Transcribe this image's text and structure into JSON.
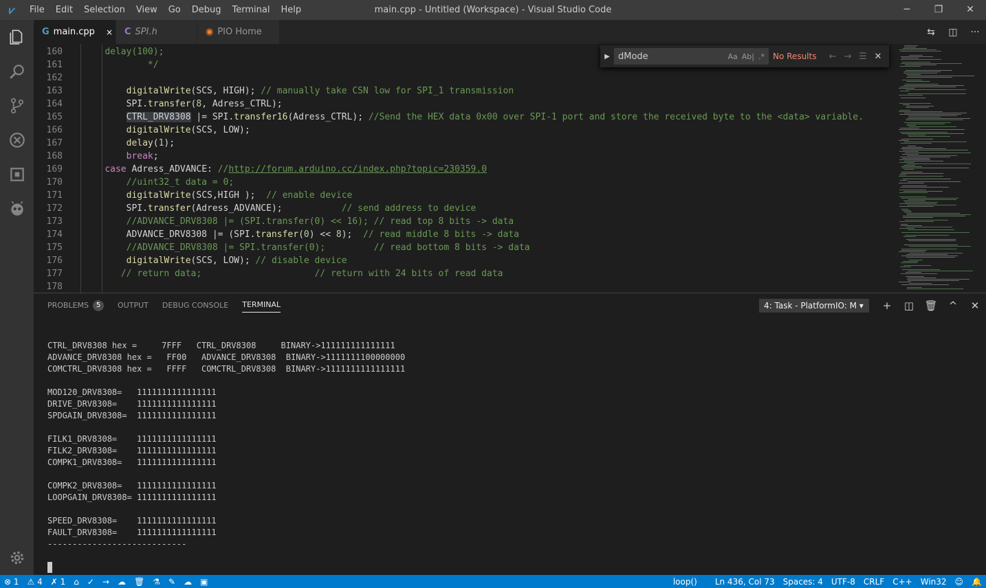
{
  "app": {
    "window_title": "main.cpp - Untitled (Workspace) - Visual Studio Code",
    "menu": [
      "File",
      "Edit",
      "Selection",
      "View",
      "Go",
      "Debug",
      "Terminal",
      "Help"
    ],
    "window_controls": [
      "─",
      "❐",
      "✕"
    ]
  },
  "tabs": [
    {
      "label": "main.cpp",
      "icon": "G",
      "active": true,
      "close": "×"
    },
    {
      "label": "SPI.h",
      "icon": "C",
      "active": false,
      "close": ""
    },
    {
      "label": "PIO Home",
      "icon": "◉",
      "active": false,
      "close": ""
    }
  ],
  "find": {
    "query": "dMode",
    "opt_case": "Aa",
    "opt_word": "Ab|",
    "opt_regex": ".*",
    "result": "No Results"
  },
  "code_lines": [
    {
      "n": "160",
      "t": "        delay(100);"
    },
    {
      "n": "161",
      "t": "            */"
    },
    {
      "n": "162",
      "t": ""
    },
    {
      "n": "163",
      "t": "        digitalWrite(SCS, HIGH); // manually take CSN low for SPI_1 transmission"
    },
    {
      "n": "164",
      "t": "        SPI.transfer(8, Adress_CTRL);"
    },
    {
      "n": "165",
      "t": "        CTRL_DRV8308 |= SPI.transfer16(Adress_CTRL); //Send the HEX data 0x00 over SPI-1 port and store the received byte to the <data> variable."
    },
    {
      "n": "166",
      "t": "        digitalWrite(SCS, LOW);"
    },
    {
      "n": "167",
      "t": "        delay(1);"
    },
    {
      "n": "168",
      "t": "        break;"
    },
    {
      "n": "169",
      "t": "    case Adress_ADVANCE: //http://forum.arduino.cc/index.php?topic=230359.0"
    },
    {
      "n": "170",
      "t": "        //uint32_t data = 0;"
    },
    {
      "n": "171",
      "t": "        digitalWrite(SCS,HIGH );  // enable device"
    },
    {
      "n": "172",
      "t": "        SPI.transfer(Adress_ADVANCE);           // send address to device"
    },
    {
      "n": "173",
      "t": "        //ADVANCE_DRV8308 |= (SPI.transfer(0) << 16); // read top 8 bits -> data"
    },
    {
      "n": "174",
      "t": "        ADVANCE_DRV8308 |= (SPI.transfer(0) << 8);  // read middle 8 bits -> data"
    },
    {
      "n": "175",
      "t": "        //ADVANCE_DRV8308 |= SPI.transfer(0);         // read bottom 8 bits -> data"
    },
    {
      "n": "176",
      "t": "        digitalWrite(SCS, LOW); // disable device"
    },
    {
      "n": "177",
      "t": "       // return data;                     // return with 24 bits of read data"
    },
    {
      "n": "178",
      "t": ""
    }
  ],
  "panel": {
    "tabs": [
      {
        "label": "PROBLEMS",
        "badge": "5"
      },
      {
        "label": "OUTPUT"
      },
      {
        "label": "DEBUG CONSOLE"
      },
      {
        "label": "TERMINAL",
        "active": true
      }
    ],
    "task_select": "4: Task - PlatformIO: M",
    "task_caret": "▾",
    "actions": [
      "+",
      "◫",
      "🗑",
      "^",
      "✕"
    ]
  },
  "terminal": "CTRL_DRV8308 hex =     7FFF   CTRL_DRV8308     BINARY->111111111111111\nADVANCE_DRV8308 hex =   FF00   ADVANCE_DRV8308  BINARY->1111111100000000\nCOMCTRL_DRV8308 hex =   FFFF   COMCTRL_DRV8308  BINARY->1111111111111111\n\nMOD120_DRV8308=   1111111111111111\nDRIVE_DRV8308=    1111111111111111\nSPDGAIN_DRV8308=  1111111111111111\n\nFILK1_DRV8308=    1111111111111111\nFILK2_DRV8308=    1111111111111111\nCOMPK1_DRV8308=   1111111111111111\n\nCOMPK2_DRV8308=   1111111111111111\nLOOPGAIN_DRV8308= 1111111111111111\n\nSPEED_DRV8308=    1111111111111111\nFAULT_DRV8308=    1111111111111111\n----------------------------",
  "status": {
    "errors": "⊗ 1",
    "warnings": "⚠ 4",
    "misc": "✗ 1",
    "icons": [
      "⌂",
      "✓",
      "→",
      "☁",
      "🗑",
      "⚗",
      "✎",
      "☁",
      "▣"
    ],
    "function": "loop()",
    "position": "Ln 436, Col 73",
    "spaces": "Spaces: 4",
    "encoding": "UTF-8",
    "eol": "CRLF",
    "language": "C++",
    "platform": "Win32",
    "feedback": "☺",
    "bell": "🔔"
  },
  "colors": {
    "accent": "#007acc",
    "activity_bar": "#333333",
    "title_bar": "#3c3c3c"
  }
}
